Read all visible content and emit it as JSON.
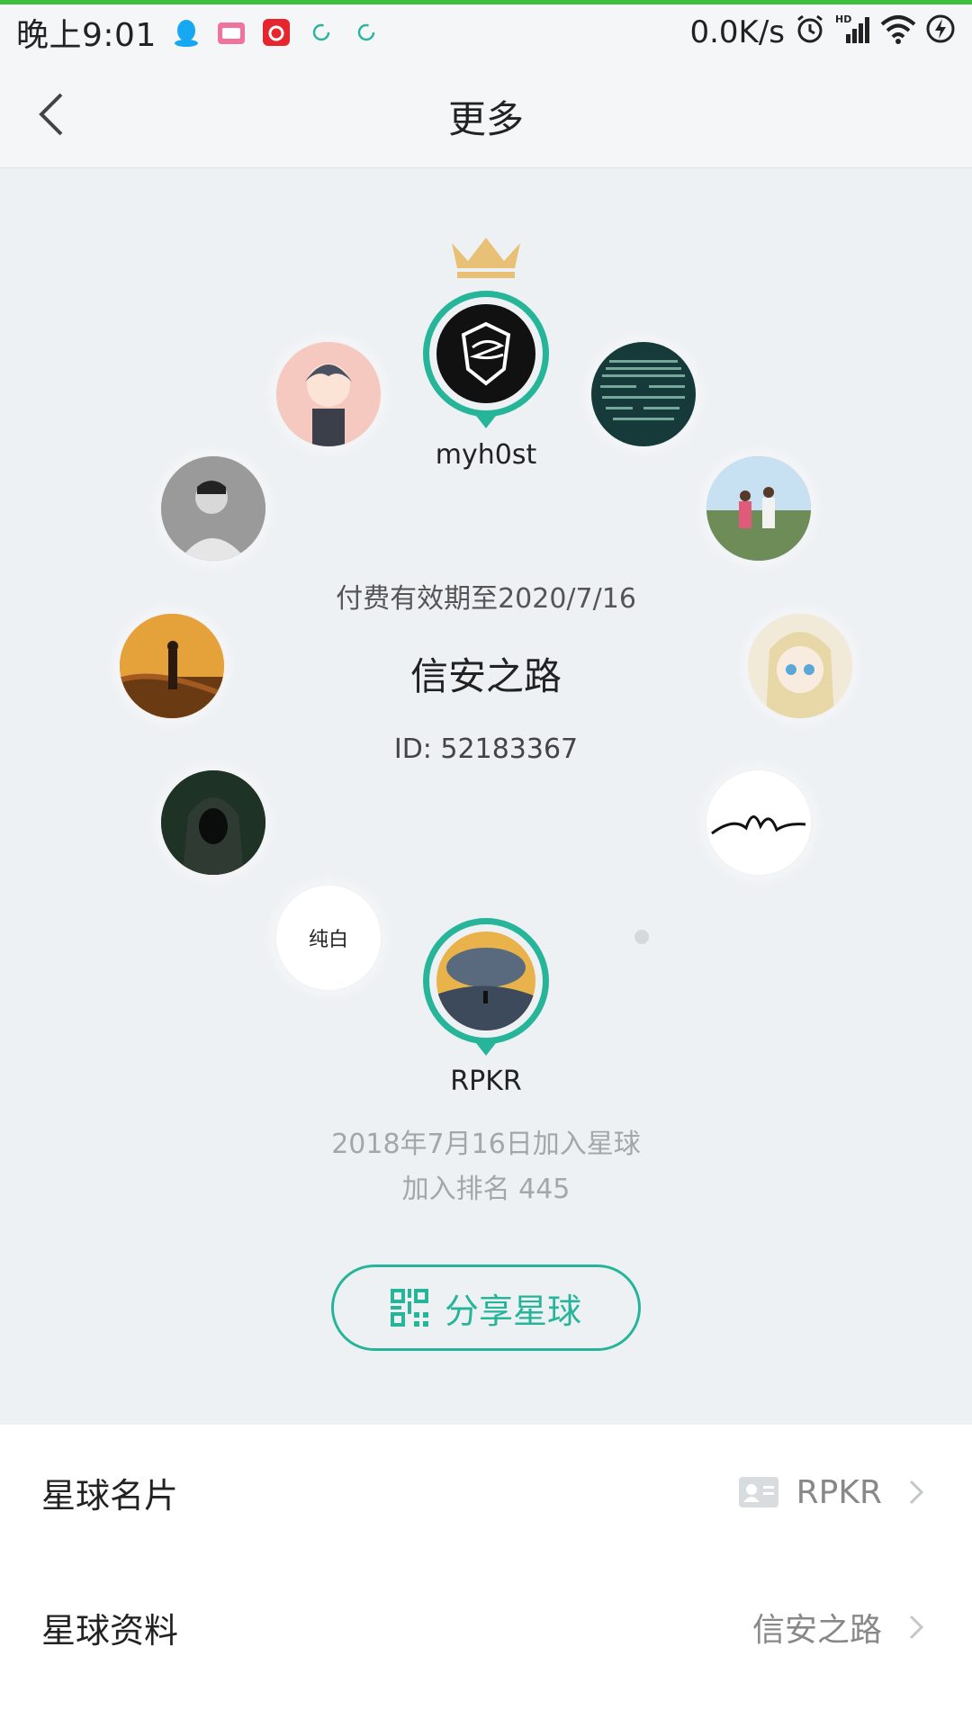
{
  "colors": {
    "accent": "#27b59a",
    "status_green": "#3cc23c",
    "crown": "#e8c176"
  },
  "status_bar": {
    "time": "晚上9:01",
    "network_speed": "0.0K/s",
    "icons": [
      "qq-icon",
      "bilibili-icon",
      "netease-music-icon",
      "sync-icon",
      "sync-icon",
      "alarm-icon",
      "hd-signal-icon",
      "wifi-icon",
      "charging-icon"
    ]
  },
  "nav": {
    "title": "更多",
    "back_icon": "back-chevron-icon"
  },
  "planet": {
    "owner_name": "myh0st",
    "crown_icon": "crown-icon",
    "paid_until": "付费有效期至2020/7/16",
    "name": "信安之路",
    "id_text": "ID: 52183367",
    "member_chun_bai": "纯白",
    "current_user": "RPKR",
    "join_date": "2018年7月16日加入星球",
    "join_rank": "加入排名 445"
  },
  "share_button": {
    "label": "分享星球",
    "icon": "qr-code-icon"
  },
  "list": [
    {
      "label": "星球名片",
      "value": "RPKR",
      "icon": "id-card-icon"
    },
    {
      "label": "星球资料",
      "value": "信安之路"
    }
  ]
}
